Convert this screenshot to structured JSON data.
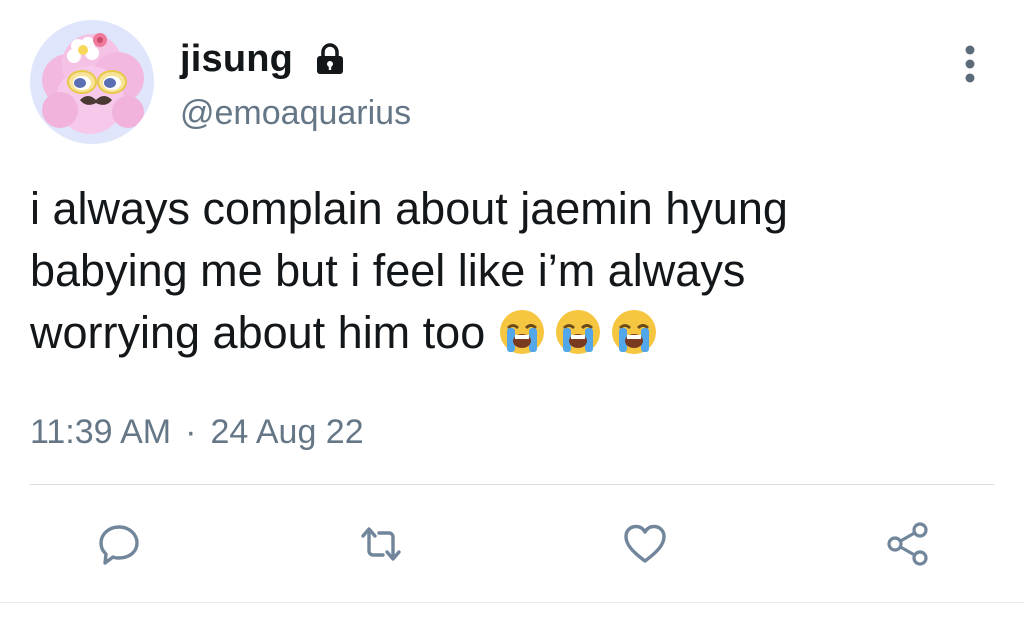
{
  "user": {
    "display_name": "jisung",
    "handle": "@emoaquarius",
    "protected_icon": "lock-icon",
    "avatar": "avatar-image"
  },
  "header": {
    "more_icon": "vertical-dots-icon"
  },
  "tweet": {
    "text": "i always complain about jaemin hyung\nbabying me but i feel like i’m always\nworrying about him too",
    "emojis": [
      "loudly-crying-face",
      "loudly-crying-face",
      "loudly-crying-face"
    ],
    "time": "11:39 AM",
    "separator": "·",
    "date": "24 Aug 22"
  },
  "actions": [
    {
      "name": "reply",
      "icon": "reply-icon"
    },
    {
      "name": "retweet",
      "icon": "retweet-icon"
    },
    {
      "name": "like",
      "icon": "heart-icon"
    },
    {
      "name": "share",
      "icon": "share-icon"
    }
  ],
  "colors": {
    "text": "#14171a",
    "secondary": "#657786",
    "icon": "#71869a",
    "divider": "#d6dde3",
    "avatar_bg": "#dfe6fb",
    "avatar_character": "#f3b8e0"
  }
}
